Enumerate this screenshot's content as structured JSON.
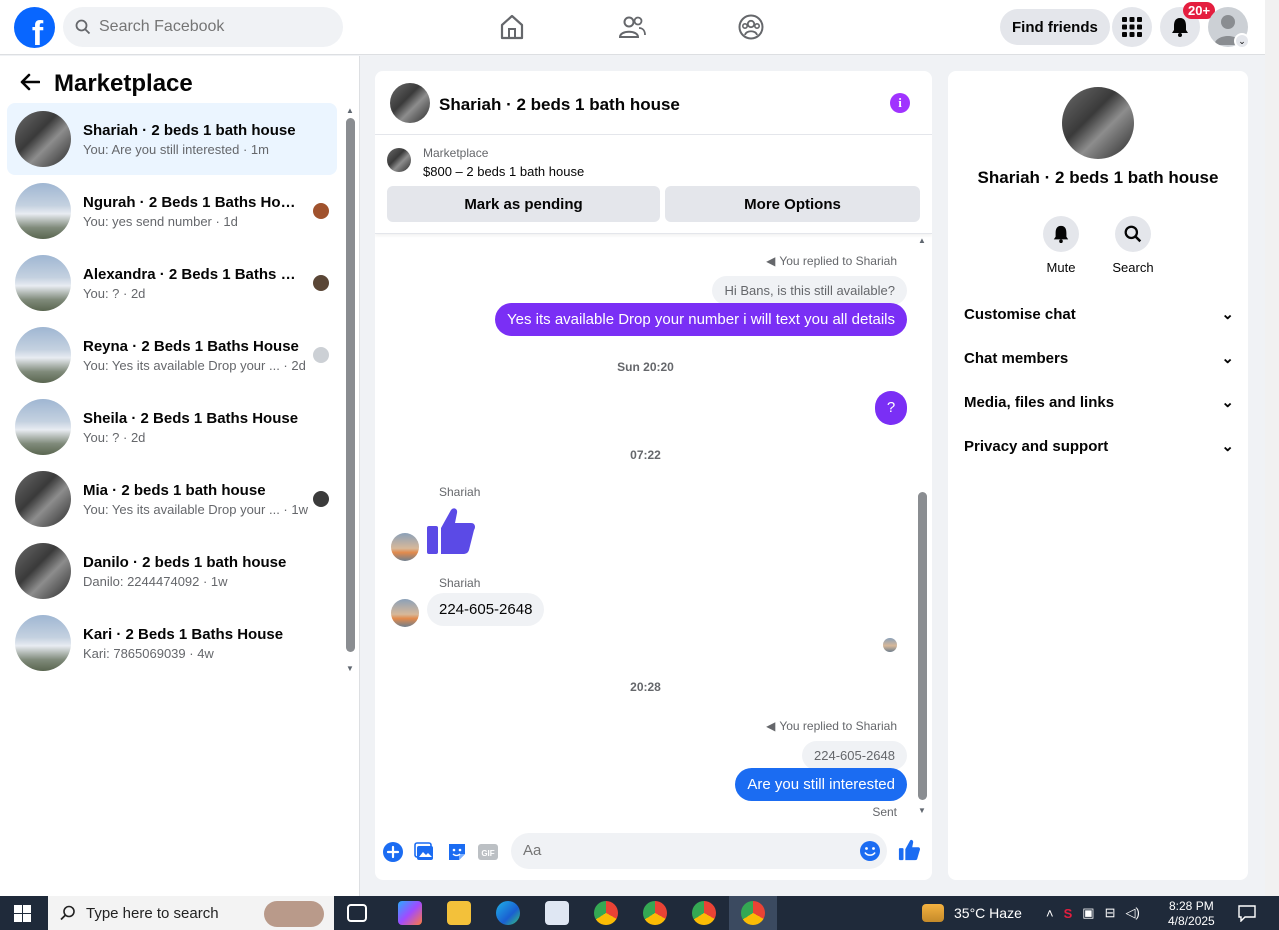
{
  "topbar": {
    "logo": "f",
    "search_placeholder": "Search Facebook",
    "find_friends": "Find friends",
    "notifications_badge": "20+"
  },
  "sidebar": {
    "title": "Marketplace",
    "conversations": [
      {
        "title": "Shariah · 2 beds 1 bath house",
        "preview": "You: Are you still interested · 1m",
        "thumb": "interior",
        "active": true
      },
      {
        "title": "Ngurah · 2 Beds 1 Baths House",
        "preview": "You: yes send number · 1d",
        "thumb": "house"
      },
      {
        "title": "Alexandra · 2 Beds 1 Baths Ho...",
        "preview": "You: ? · 2d",
        "thumb": "house"
      },
      {
        "title": "Reyna · 2 Beds 1 Baths House",
        "preview": "You: Yes its available Drop your ...  · 2d",
        "thumb": "house"
      },
      {
        "title": "Sheila · 2 Beds 1 Baths House",
        "preview": "You: ? · 2d",
        "thumb": "house"
      },
      {
        "title": "Mia · 2 beds 1 bath house",
        "preview": "You: Yes its available Drop your ...  · 1w",
        "thumb": "interior"
      },
      {
        "title": "Danilo · 2 beds 1 bath house",
        "preview": "Danilo: 2244474092 · 1w",
        "thumb": "interior"
      },
      {
        "title": "Kari · 2 Beds 1 Baths House",
        "preview": "Kari: 7865069039 · 4w",
        "thumb": "house"
      }
    ]
  },
  "chat": {
    "header_name": "Shariah · 2 beds 1 bath house",
    "marketplace_label": "Marketplace",
    "listing": "$800 – 2 beds 1 bath house",
    "mark_pending": "Mark as pending",
    "more_options": "More Options",
    "reply_note_1": "You replied to Shariah",
    "quoted_1": "Hi Bans, is this still available?",
    "msg_out_1": "Yes its available Drop your number i will text you all details",
    "time_1": "Sun 20:20",
    "msg_out_2": "?",
    "time_2": "07:22",
    "sender_1": "Shariah",
    "sender_2": "Shariah",
    "msg_in_2": "224-605-2648",
    "time_3": "20:28",
    "reply_note_2": "You replied to Shariah",
    "quoted_2": "224-605-2648",
    "msg_out_3": "Are you still interested",
    "status": "Sent",
    "composer_placeholder": "Aa",
    "accent": "#7a2ff5",
    "accent_blue": "#1b6cf2"
  },
  "details": {
    "name": "Shariah · 2 beds 1 bath house",
    "mute": "Mute",
    "search": "Search",
    "sections": [
      "Customise chat",
      "Chat members",
      "Media, files and links",
      "Privacy and support"
    ]
  },
  "taskbar": {
    "search_placeholder": "Type here to search",
    "weather": "35°C  Haze",
    "time": "8:28 PM",
    "date": "4/8/2025"
  }
}
